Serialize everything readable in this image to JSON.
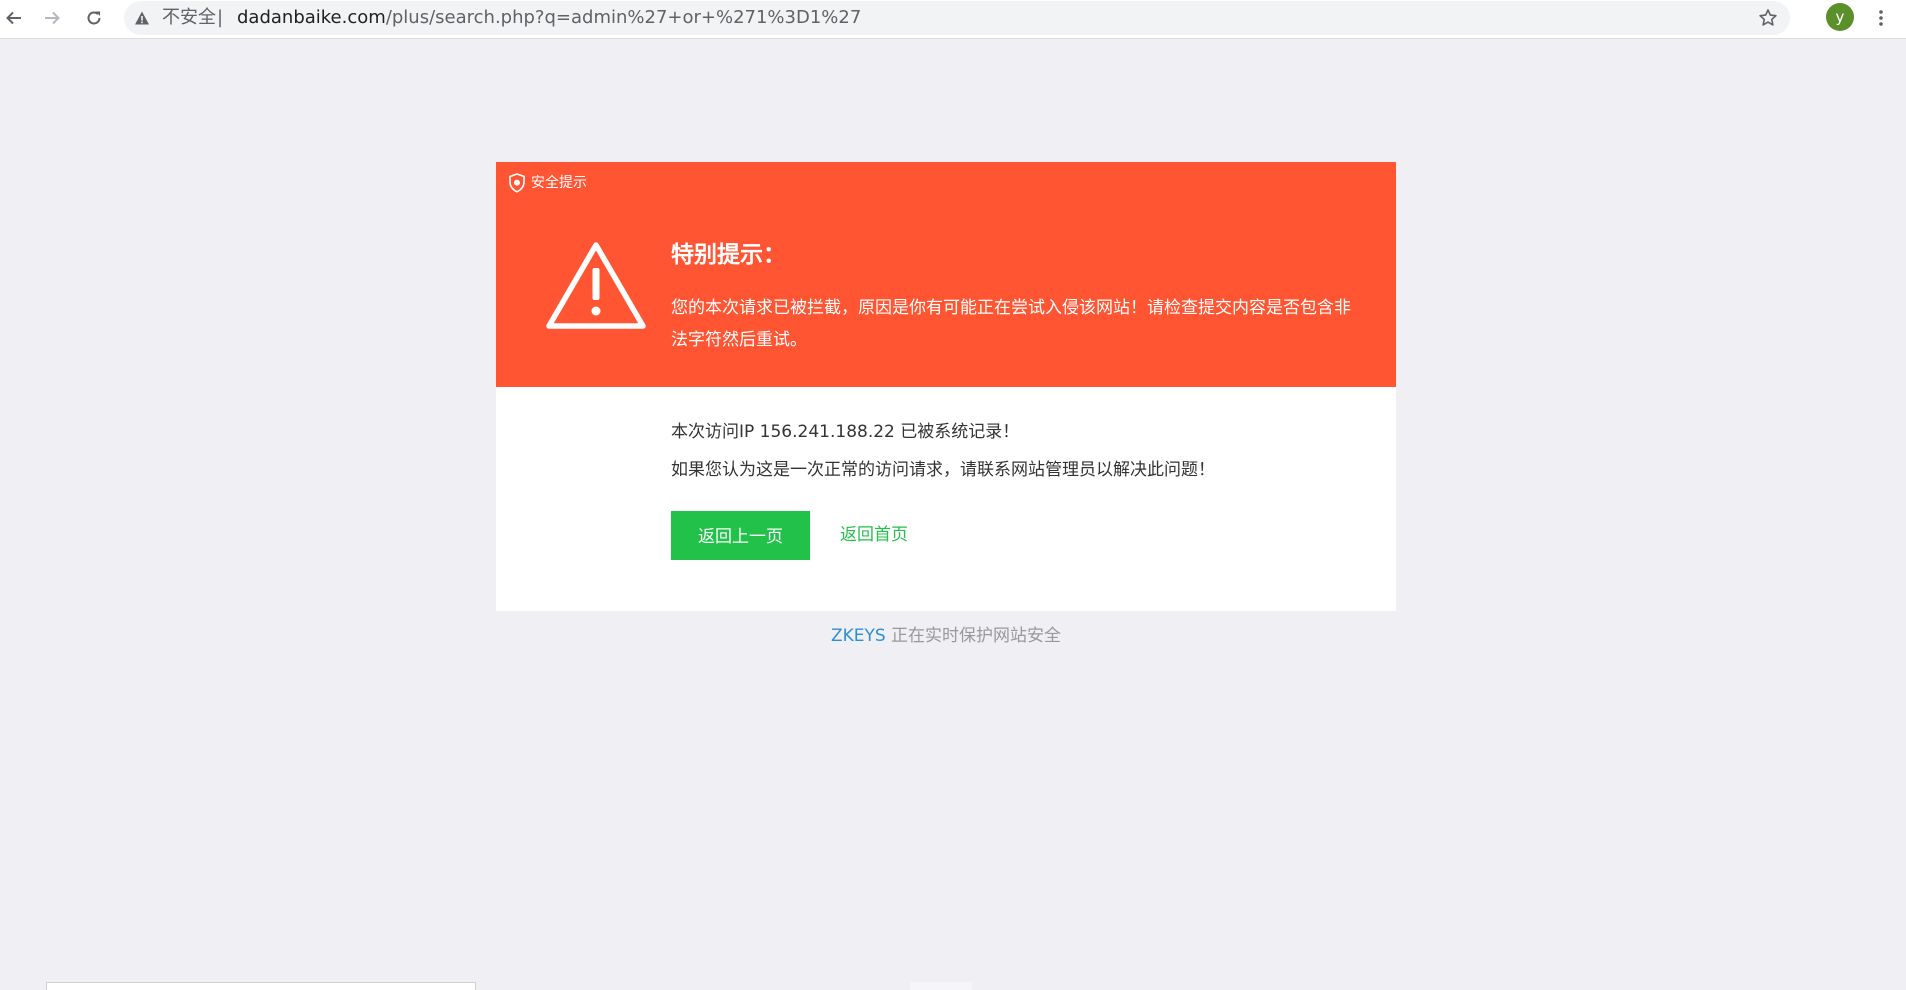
{
  "browser": {
    "security_label": "不安全",
    "separator": "|",
    "url_host": "dadanbaike.com",
    "url_path": "/plus/search.php?q=admin%27+or+%271%3D1%27",
    "profile_initial": "y",
    "icons": [
      "back-arrow-icon",
      "forward-arrow-icon",
      "reload-icon",
      "not-secure-warning-icon",
      "bookmark-star-icon",
      "kebab-menu-icon"
    ]
  },
  "alert": {
    "badge_label": "安全提示",
    "title": "特别提示：",
    "message": "您的本次请求已被拦截，原因是你有可能正在尝试入侵该网站！请检查提交内容是否包含非法字符然后重试。",
    "ip_notice": "本次访问IP 156.241.188.22 已被系统记录！",
    "contact_notice": "如果您认为这是一次正常的访问请求，请联系网站管理员以解决此问题！",
    "back_button_label": "返回上一页",
    "home_link_label": "返回首页",
    "colors": {
      "header_bg": "#ff5533",
      "button_green": "#22c14a",
      "page_bg": "#efeff4"
    }
  },
  "footer": {
    "brand": "ZKEYS",
    "text": " 正在实时保护网站安全",
    "brand_color": "#2d8fd5"
  }
}
